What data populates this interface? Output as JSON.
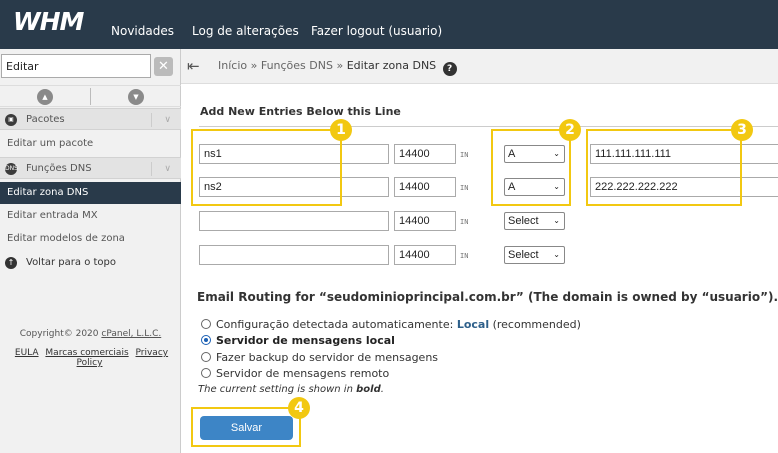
{
  "header": {
    "logo": "WHM",
    "nav": [
      "Novidades",
      "Log de alterações",
      "Fazer logout (usuario)"
    ]
  },
  "sidebar": {
    "search_value": "Editar",
    "clear_glyph": "✕",
    "items": [
      {
        "label": "Pacotes",
        "icon": "box-icon"
      },
      {
        "label": "Editar um pacote"
      },
      {
        "label": "Funções DNS",
        "icon": "dns-icon",
        "icon_text": "DNS"
      },
      {
        "label": "Editar zona DNS"
      },
      {
        "label": "Editar entrada MX"
      },
      {
        "label": "Editar modelos de zona"
      },
      {
        "label": "Voltar para o topo",
        "icon": "arrow-up-icon"
      }
    ],
    "copyright_prefix": "Copyright© 2020",
    "copyright_link": "cPanel, L.L.C.",
    "footer_links": [
      "EULA",
      "Marcas comerciais",
      "Privacy Policy"
    ]
  },
  "breadcrumb": {
    "items": [
      "Início",
      "Funções DNS",
      "Editar zona DNS"
    ],
    "separator": "»"
  },
  "main": {
    "section_title": "Add New Entries Below this Line",
    "rows": [
      {
        "name": "ns1",
        "ttl": "14400",
        "class": "IN",
        "type": "A",
        "address": "111.111.111.111"
      },
      {
        "name": "ns2",
        "ttl": "14400",
        "class": "IN",
        "type": "A",
        "address": "222.222.222.222"
      },
      {
        "name": "",
        "ttl": "14400",
        "class": "IN",
        "type": "Select",
        "address": ""
      },
      {
        "name": "",
        "ttl": "14400",
        "class": "IN",
        "type": "Select",
        "address": ""
      }
    ],
    "email_title": "Email Routing for “seudominioprincipal.com.br” (The domain is owned by “usuario”).",
    "options": [
      {
        "label": "Configuração detectada automaticamente:",
        "value": "Local",
        "suffix": "(recommended)",
        "checked": false
      },
      {
        "label": "Servidor de mensagens local",
        "checked": true
      },
      {
        "label": "Fazer backup do servidor de mensagens",
        "checked": false
      },
      {
        "label": "Servidor de mensagens remoto",
        "checked": false
      }
    ],
    "note_prefix": "The current setting is shown in ",
    "note_bold": "bold",
    "note_suffix": ".",
    "save_label": "Salvar"
  },
  "callouts": [
    "1",
    "2",
    "3",
    "4"
  ],
  "colors": {
    "header_bg": "#293a4a",
    "highlight": "#f2c811",
    "save_button": "#3d85c6"
  }
}
